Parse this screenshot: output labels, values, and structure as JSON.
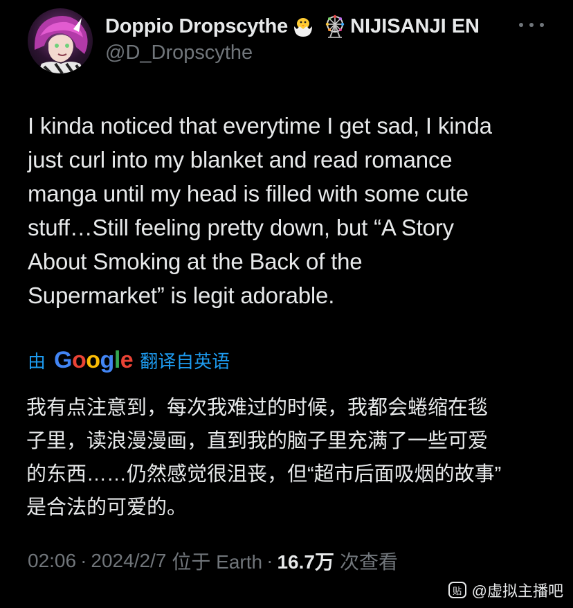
{
  "author": {
    "display_name": "Doppio Dropscythe",
    "affiliation": "NIJISANJI EN",
    "handle": "@D_Dropscythe",
    "name_icons": [
      "hatching-chick-icon",
      "ferris-wheel-icon"
    ]
  },
  "tweet": {
    "text": "I kinda noticed that everytime I get sad, I kinda\njust curl into my blanket and read romance\nmanga until my head is filled with some cute\nstuff…Still feeling pretty down, but “A Story\nAbout Smoking at the Back of the\nSupermarket” is legit adorable."
  },
  "translation": {
    "prefix": "由",
    "provider": "Google",
    "suffix": "翻译自英语",
    "text": "我有点注意到，每次我难过的时候，我都会蜷缩在毯\n子里，读浪漫漫画，直到我的脑子里充满了一些可爱\n的东西……仍然感觉很沮丧，但“超市后面吸烟的故事”\n是合法的可爱的。"
  },
  "meta": {
    "time": "02:06",
    "separator": "·",
    "date": "2024/2/7",
    "location": "位于 Earth",
    "views_count": "16.7万",
    "views_label": "次查看"
  },
  "watermark": {
    "icon_label": "贴",
    "text": "@虚拟主播吧"
  },
  "colors": {
    "background": "#000000",
    "primary_text": "#e7e9ea",
    "secondary_text": "#71767b",
    "link_blue": "#1d9bf0"
  }
}
